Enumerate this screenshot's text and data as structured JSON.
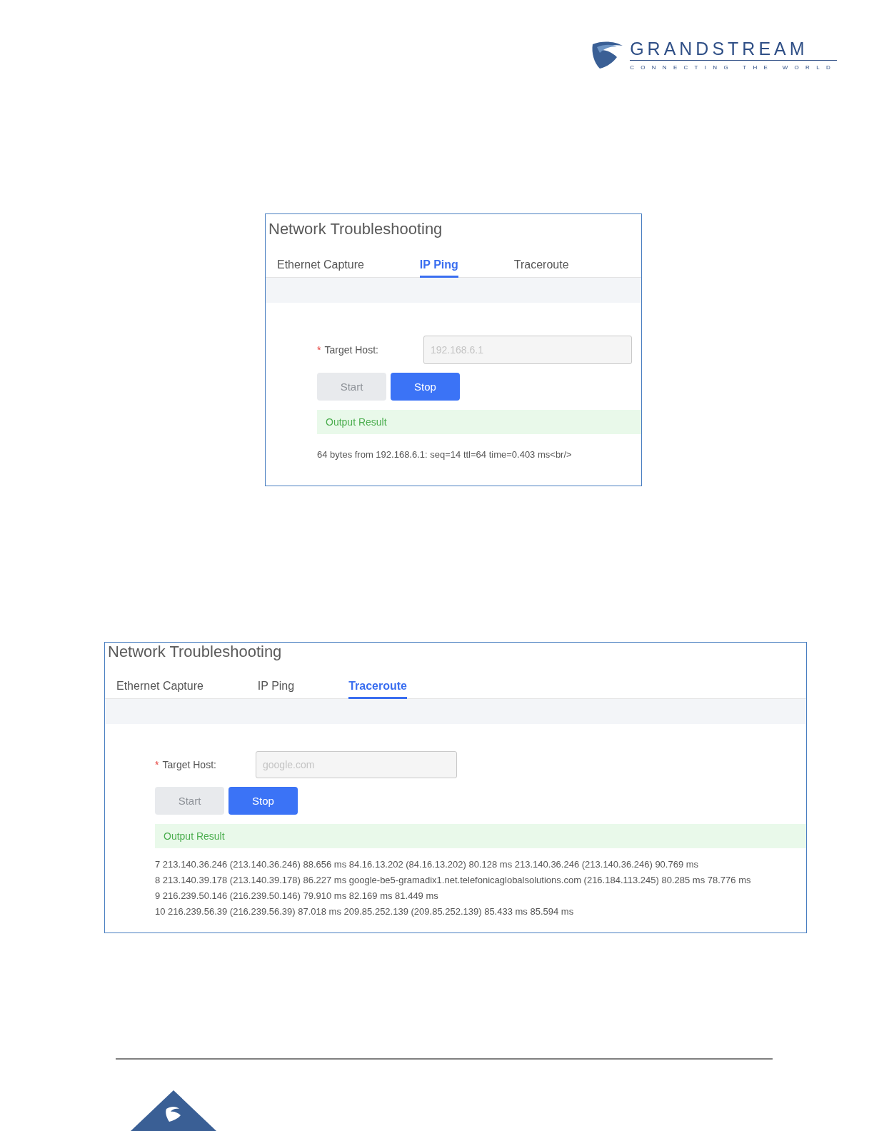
{
  "logo": {
    "name": "GRANDSTREAM",
    "tagline": "CONNECTING THE WORLD"
  },
  "panels": [
    {
      "title": "Network Troubleshooting",
      "tabs": [
        {
          "label": "Ethernet Capture",
          "selected": false
        },
        {
          "label": "IP Ping",
          "selected": true
        },
        {
          "label": "Traceroute",
          "selected": false
        }
      ],
      "field": {
        "required_mark": "*",
        "label": "Target Host:",
        "value": "192.168.6.1",
        "disabled": true
      },
      "buttons": [
        {
          "label": "Start",
          "disabled": true
        },
        {
          "label": "Stop",
          "disabled": false
        }
      ],
      "output": {
        "title": "Output Result",
        "lines": [
          "64 bytes from 192.168.6.1: seq=14 ttl=64 time=0.403 ms<br/>"
        ]
      }
    },
    {
      "title": "Network Troubleshooting",
      "tabs": [
        {
          "label": "Ethernet Capture",
          "selected": false
        },
        {
          "label": "IP Ping",
          "selected": false
        },
        {
          "label": "Traceroute",
          "selected": true
        }
      ],
      "field": {
        "required_mark": "*",
        "label": "Target Host:",
        "value": "google.com",
        "disabled": true
      },
      "buttons": [
        {
          "label": "Start",
          "disabled": true
        },
        {
          "label": "Stop",
          "disabled": false
        }
      ],
      "output": {
        "title": "Output Result",
        "lines": [
          "7 213.140.36.246 (213.140.36.246) 88.656 ms 84.16.13.202 (84.16.13.202) 80.128 ms 213.140.36.246 (213.140.36.246) 90.769 ms",
          "8 213.140.39.178 (213.140.39.178) 86.227 ms google-be5-gramadix1.net.telefonicaglobalsolutions.com (216.184.113.245) 80.285 ms 78.776 ms",
          "9 216.239.50.146 (216.239.50.146) 79.910 ms 82.169 ms 81.449 ms",
          "10 216.239.56.39 (216.239.56.39) 87.018 ms 209.85.252.139 (209.85.252.139) 85.433 ms 85.594 ms"
        ]
      }
    }
  ]
}
